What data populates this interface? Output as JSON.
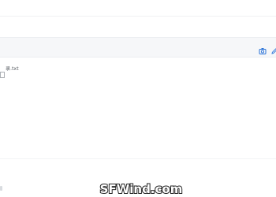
{
  "file_list": {
    "item_name": "录.txt"
  },
  "toolbar": {
    "icons": [
      "camera-icon",
      "edit-icon"
    ]
  },
  "watermark": {
    "text": "SFWind.com"
  },
  "colors": {
    "toolbar_bg": "#f6f7f9",
    "icon_blue": "#2b73d8",
    "text": "#555a60"
  }
}
